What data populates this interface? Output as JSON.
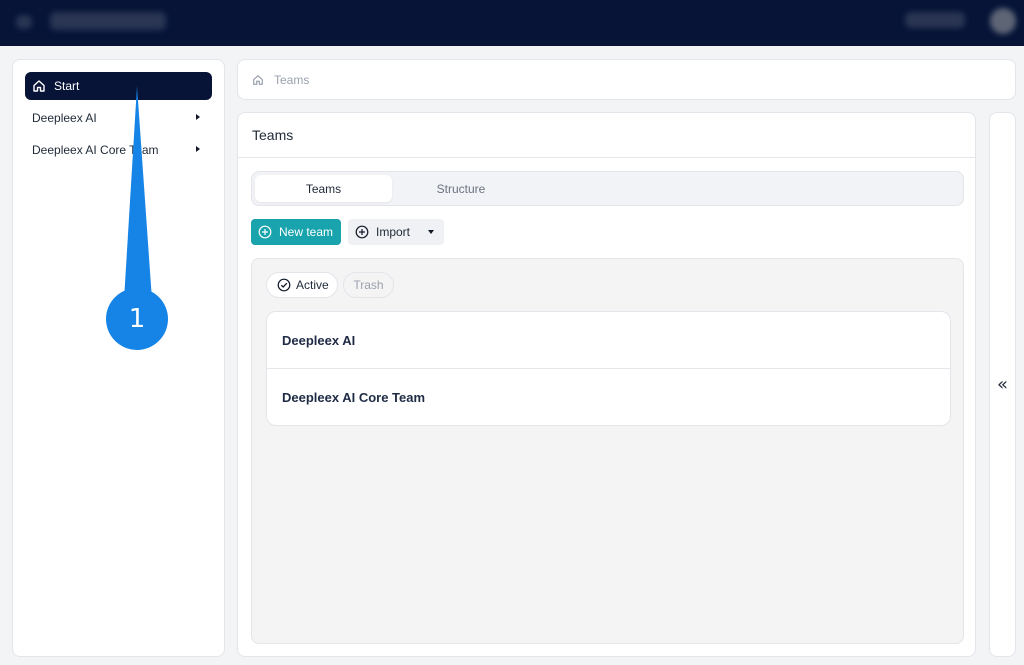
{
  "sidebar": {
    "items": [
      {
        "label": "Start",
        "icon": "home-icon",
        "active": true
      },
      {
        "label": "Deepleex AI",
        "icon": "caret-right-icon"
      },
      {
        "label": "Deepleex AI Core Team",
        "icon": "caret-right-icon"
      }
    ]
  },
  "breadcrumb": {
    "icon": "home-icon",
    "label": "Teams"
  },
  "main": {
    "title": "Teams",
    "tabs": [
      {
        "label": "Teams",
        "selected": true
      },
      {
        "label": "Structure",
        "selected": false
      }
    ],
    "new_team_label": "New team",
    "import_label": "Import",
    "filters": [
      {
        "label": "Active",
        "selected": true
      },
      {
        "label": "Trash",
        "selected": false
      }
    ],
    "teams": [
      "Deepleex AI",
      "Deepleex AI Core Team"
    ]
  },
  "collapse_toggle": "«",
  "callout": {
    "number": "1",
    "color": "#1684e6"
  },
  "colors": {
    "topbar": "#071438",
    "accent": "#19a3ad",
    "active_sidebar": "#071438"
  }
}
